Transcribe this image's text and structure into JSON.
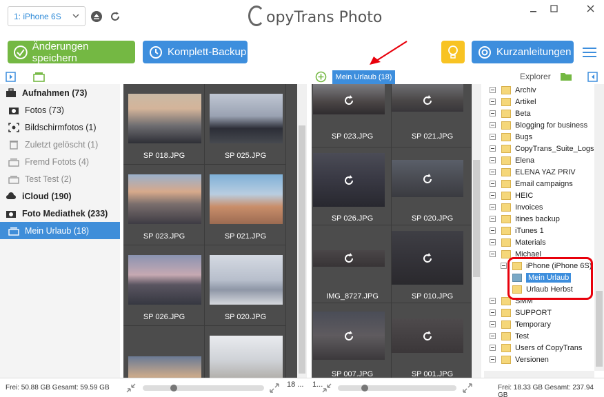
{
  "header": {
    "device": "1: iPhone 6S",
    "logo_text": "opyTrans Photo",
    "logo_c": "C"
  },
  "toolbar": {
    "save_label": "Änderungen speichern",
    "backup_label": "Komplett-Backup",
    "guide_label": "Kurzanleitungen"
  },
  "sidebar": {
    "items": [
      {
        "label": "Aufnahmen (73)",
        "icon": "briefcase-icon"
      },
      {
        "label": "Fotos (73)",
        "icon": "camera-icon"
      },
      {
        "label": "Bildschirmfotos (1)",
        "icon": "screenshot-icon"
      },
      {
        "label": "Zuletzt gelöscht (1)",
        "icon": "trash-icon"
      },
      {
        "label": "Fremd Fotots (4)",
        "icon": "album-icon"
      },
      {
        "label": "Test Test (2)",
        "icon": "album-icon"
      },
      {
        "label": "iCloud (190)",
        "icon": "cloud-icon"
      },
      {
        "label": "Foto Mediathek (233)",
        "icon": "camera-icon"
      },
      {
        "label": "Mein Urlaub (18)",
        "icon": "album-icon"
      }
    ]
  },
  "left_grid": {
    "photos": [
      "SP 018.JPG",
      "SP 025.JPG",
      "SP 023.JPG",
      "SP 021.JPG",
      "SP 026.JPG",
      "SP 020.JPG",
      "",
      ""
    ],
    "count": "18 ..."
  },
  "middle": {
    "album_tab": "Mein Urlaub (18)",
    "photos": [
      "SP 023.JPG",
      "SP 021.JPG",
      "SP 026.JPG",
      "SP 020.JPG",
      "IMG_8727.JPG",
      "SP 010.JPG",
      "SP 007.JPG",
      "SP 001.JPG"
    ],
    "count": "1..."
  },
  "explorer": {
    "label": "Explorer",
    "folders": [
      "Archiv",
      "Artikel",
      "Beta",
      "Blogging for business",
      "Bugs",
      "CopyTrans_Suite_Logs",
      "Elena",
      "ELENA YAZ PRIV",
      "Email campaigns",
      "HEIC",
      "Invoices",
      "Itines backup",
      "iTunes 1",
      "Materials",
      "Michael"
    ],
    "subfolders": [
      "iPhone (iPhone 6S)",
      "Mein Urlaub",
      "Urlaub Herbst"
    ],
    "folders_after": [
      "SMM",
      "SUPPORT",
      "Temporary",
      "Test",
      "Users of CopyTrans",
      "Versionen"
    ]
  },
  "status": {
    "left": "Frei: 50.88 GB Gesamt: 59.59 GB",
    "right": "Frei: 18.33 GB Gesamt: 237.94 GB"
  },
  "colors": {
    "accent_blue": "#3d8edd",
    "save_green": "#74b843",
    "tip_yellow": "#f8c323",
    "highlight_red": "#e8000b"
  }
}
